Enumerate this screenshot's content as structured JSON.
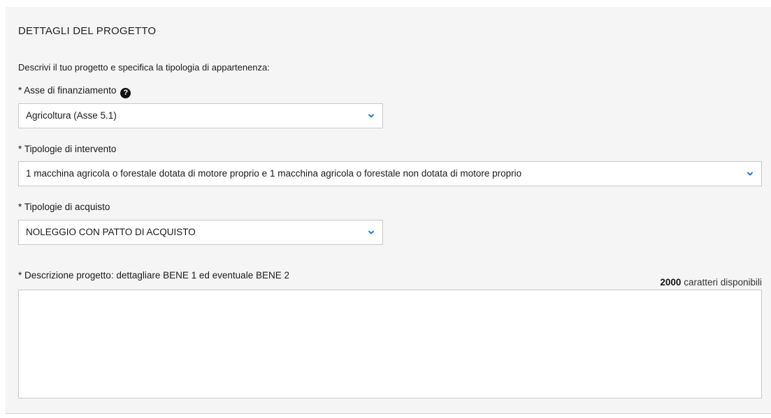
{
  "section": {
    "title": "DETTAGLI DEL PROGETTO"
  },
  "intro": "Descrivi il tuo progetto e specifica la tipologia di appartenenza:",
  "asse": {
    "label": "* Asse di finanziamento",
    "help_icon": "question-circle-icon",
    "value": "Agricoltura (Asse 5.1)"
  },
  "tipologie_intervento": {
    "label": "* Tipologie di intervento",
    "value": "1 macchina agricola o forestale dotata di motore proprio e 1 macchina agricola o forestale non dotata di motore proprio"
  },
  "tipologie_acquisto": {
    "label": "* Tipologie di acquisto",
    "value": "NOLEGGIO CON PATTO DI ACQUISTO"
  },
  "descrizione": {
    "label": "* Descrizione progetto: dettagliare BENE 1 ed eventuale BENE 2",
    "chars_count": "2000",
    "chars_suffix": " caratteri disponibili",
    "value": ""
  },
  "colors": {
    "chevron": "#2a7ad5",
    "panel_bg": "#f5f5f5"
  }
}
